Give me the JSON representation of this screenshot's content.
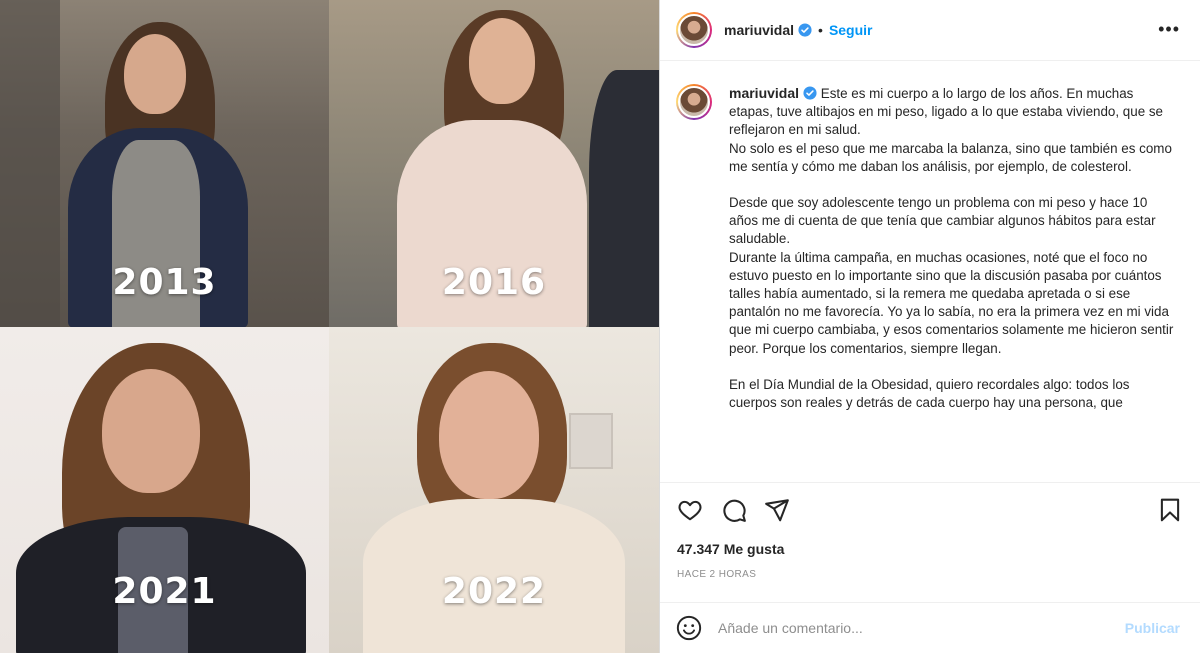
{
  "collage": {
    "years": [
      "2013",
      "2016",
      "2021",
      "2022"
    ]
  },
  "post": {
    "username": "mariuvidal",
    "follow_label": "Seguir",
    "dot": "•",
    "more_icon": "•••",
    "caption_paragraphs": [
      "Este es mi cuerpo a lo largo de los años. En muchas etapas, tuve altibajos en mi peso, ligado a lo que estaba viviendo, que se reflejaron en mi salud.",
      "No solo es el peso que me marcaba la balanza, sino que también es como me sentía y cómo me daban los análisis, por ejemplo, de colesterol.",
      "Desde que soy adolescente tengo un problema con mi peso y hace 10 años me di cuenta de que tenía que cambiar algunos hábitos para estar saludable.",
      "Durante la última campaña, en muchas ocasiones, noté que el foco no estuvo puesto en lo importante sino que la discusión pasaba por cuántos talles había aumentado, si la remera me quedaba apretada o si ese pantalón no me favorecía. Yo ya lo sabía, no era la primera vez en mi vida que mi cuerpo cambiaba, y esos comentarios solamente me hicieron sentir peor. Porque los comentarios, siempre llegan.",
      "En el Día Mundial de la Obesidad, quiero recordales algo: todos los cuerpos son reales y detrás de cada cuerpo hay una persona, que"
    ],
    "likes": "47.347 Me gusta",
    "time": "HACE 2 HORAS",
    "comment_placeholder": "Añade un comentario...",
    "publish_label": "Publicar"
  },
  "colors": {
    "accent": "#0095f6",
    "publish_disabled": "#b3dbff",
    "verified": "#3897f0"
  }
}
